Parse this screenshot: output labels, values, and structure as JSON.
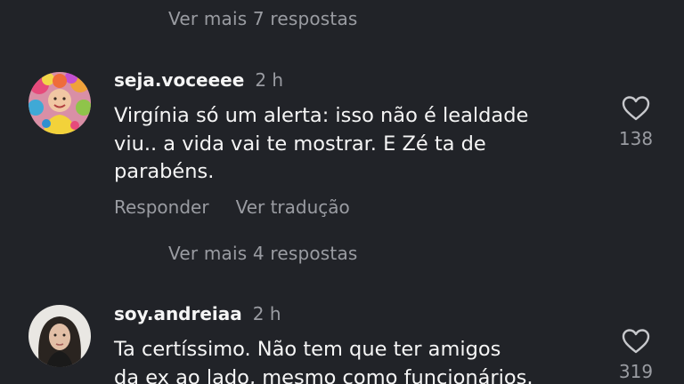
{
  "thread": {
    "more_replies_top": "Ver mais 7 respostas",
    "more_replies_mid": "Ver mais 4 respostas"
  },
  "comments": [
    {
      "username": "seja.voceeee",
      "time": "2 h",
      "text_lines": [
        "Virgínia só um alerta: isso não é lealdade",
        "viu.. a vida vai te mostrar. E Zé ta de",
        "parabéns."
      ],
      "reply_label": "Responder",
      "translate_label": "Ver tradução",
      "likes": "138",
      "like_icon": "heart-outline-icon"
    },
    {
      "username": "soy.andreiaa",
      "time": "2 h",
      "text_lines": [
        "Ta certíssimo.  Não tem que ter amigos",
        "da ex ao lado, mesmo como funcionários."
      ],
      "likes": "319",
      "like_icon": "heart-outline-icon"
    }
  ],
  "colors": {
    "background": "#212328",
    "primary_text": "#f5f5f5",
    "secondary_text": "#9a9ca2"
  }
}
